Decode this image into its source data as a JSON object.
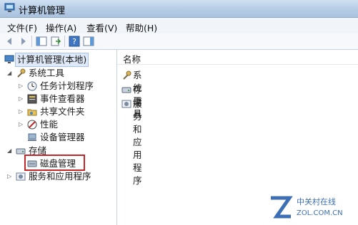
{
  "window": {
    "title": "计算机管理"
  },
  "menubar": {
    "items": [
      "文件(F)",
      "操作(A)",
      "查看(V)",
      "帮助(H)"
    ]
  },
  "toolbar": {
    "buttons": [
      "back-icon",
      "forward-icon",
      "console-tree-icon",
      "export-list-icon",
      "help-icon",
      "action-pane-icon"
    ]
  },
  "tree": {
    "root": "计算机管理(本地)",
    "system_tools": "系统工具",
    "task_scheduler": "任务计划程序",
    "event_viewer": "事件查看器",
    "shared_folders": "共享文件夹",
    "performance": "性能",
    "device_manager": "设备管理器",
    "storage": "存储",
    "disk_management": "磁盘管理",
    "services_apps": "服务和应用程序"
  },
  "list": {
    "column_header": "名称",
    "items": [
      "系统工具",
      "存储",
      "服务和应用程序"
    ]
  },
  "watermark": {
    "brand": "中关村在线",
    "site": "ZOL.COM.CN"
  }
}
